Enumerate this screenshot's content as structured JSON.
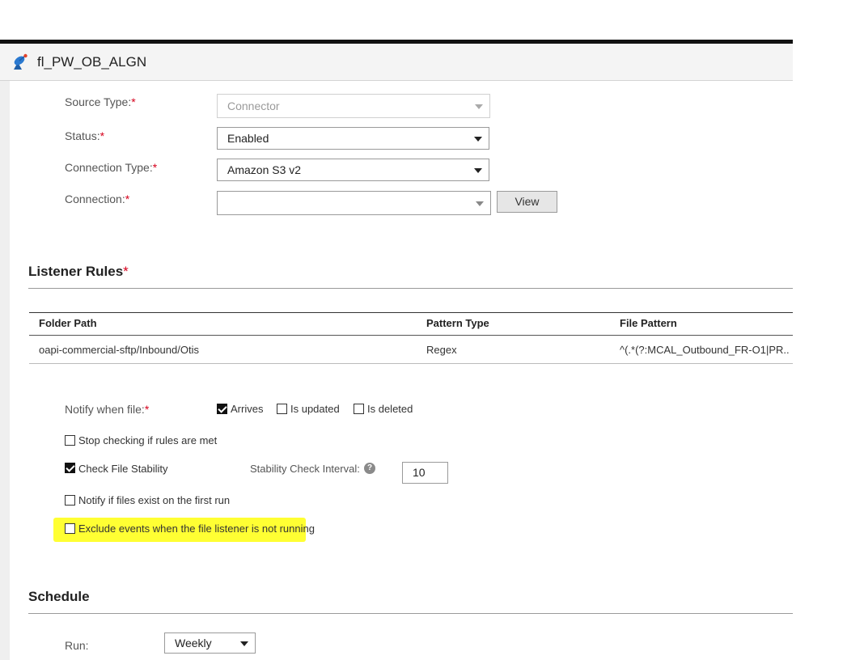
{
  "app": {
    "title": "fl_PW_OB_ALGN",
    "icon": "satellite-dish-icon"
  },
  "source": {
    "source_type_label": "Source Type:",
    "source_type_required": "*",
    "source_type_value": "Connector",
    "status_label": "Status:",
    "status_required": "*",
    "status_value": "Enabled",
    "connection_type_label": "Connection Type:",
    "connection_type_required": "*",
    "connection_type_value": "Amazon S3 v2",
    "connection_label": "Connection:",
    "connection_required": "*",
    "connection_value": "",
    "view_button": "View"
  },
  "listener_rules": {
    "title": "Listener Rules",
    "required": "*",
    "columns": [
      "Folder Path",
      "Pattern Type",
      "File Pattern"
    ],
    "rows": [
      [
        "oapi-commercial-sftp/Inbound/Otis",
        "Regex",
        "^(.*(?:MCAL_Outbound_FR-O1|PR.."
      ]
    ]
  },
  "notify": {
    "label": "Notify when file:",
    "required": "*",
    "arrives": {
      "label": "Arrives",
      "checked": true
    },
    "is_updated": {
      "label": "Is updated",
      "checked": false
    },
    "is_deleted": {
      "label": "Is deleted",
      "checked": false
    }
  },
  "options": {
    "stop_checking": {
      "label": "Stop checking if rules are met",
      "checked": false
    },
    "check_stability": {
      "label": "Check File Stability",
      "checked": true
    },
    "stability_interval_label": "Stability Check Interval:",
    "stability_interval_value": "10",
    "notify_first_run": {
      "label": "Notify if files exist on the first run",
      "checked": false
    },
    "exclude_events": {
      "label": "Exclude events when the file listener is not running",
      "checked": false,
      "highlight_color": "#ffff33"
    }
  },
  "schedule": {
    "title": "Schedule",
    "run_label": "Run:",
    "run_value": "Weekly"
  }
}
